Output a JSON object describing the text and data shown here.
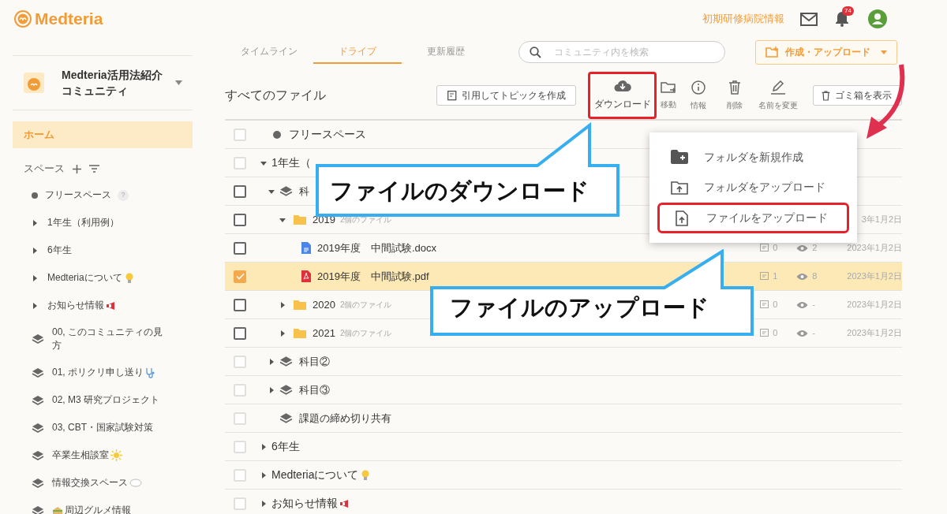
{
  "header": {
    "logo": "Medteria",
    "link": "初期研修病院情報",
    "notification_count": "74"
  },
  "community": {
    "name": "Medteria活用法紹介コミュニティ"
  },
  "sidebar": {
    "home": {
      "label": "ホーム",
      "selected": true
    },
    "spaces_label": "スペース",
    "items": [
      {
        "kind": "dot",
        "label": "フリースペース",
        "help": "?"
      },
      {
        "kind": "group",
        "label": "1年生（利用例）"
      },
      {
        "kind": "group",
        "label": "6年生"
      },
      {
        "kind": "group",
        "label": "Medteriaについて"
      },
      {
        "kind": "group",
        "label": "お知らせ情報"
      },
      {
        "kind": "space",
        "label": "00, このコミュニティの見方"
      },
      {
        "kind": "space",
        "label": "01, ポリクリ申し送り"
      },
      {
        "kind": "space",
        "label": "02, M3 研究プロジェクト"
      },
      {
        "kind": "space",
        "label": "03, CBT・国家試験対策"
      },
      {
        "kind": "space",
        "label": "卒業生相談室"
      },
      {
        "kind": "space",
        "label": "情報交換スペース"
      },
      {
        "kind": "space",
        "label": "周辺グルメ情報"
      }
    ]
  },
  "tabs": [
    {
      "label": "タイムライン",
      "selected": false
    },
    {
      "label": "ドライブ",
      "selected": true
    },
    {
      "label": "更新履歴",
      "selected": false
    }
  ],
  "search": {
    "placeholder": "コミュニティ内を検索"
  },
  "create_button": "作成・アップロード",
  "files": {
    "heading": "すべてのファイル",
    "quote_button": "引用してトピックを作成",
    "actions": [
      {
        "kind": "download",
        "label": "ダウンロード",
        "highlighted": true
      },
      {
        "kind": "move",
        "label": "移動",
        "highlighted": false
      },
      {
        "kind": "info",
        "label": "情報",
        "highlighted": false
      },
      {
        "kind": "delete",
        "label": "削除",
        "highlighted": false
      },
      {
        "kind": "rename",
        "label": "名前を変更",
        "highlighted": false
      }
    ],
    "trash_button": "ゴミ箱を表示",
    "rows": [
      {
        "kind": "dot",
        "name": "フリースペース",
        "checked": false,
        "disabled": true
      },
      {
        "kind": "group",
        "name": "1年生（",
        "checked": false,
        "disabled": true,
        "expanded": true,
        "children": [
          {
            "kind": "space",
            "name": "科",
            "checked": false,
            "disabled": false,
            "expanded": true,
            "children": [
              {
                "kind": "folder",
                "name": "2019",
                "count": "2個のファイル",
                "checked": false,
                "disabled": false,
                "expanded": true,
                "date": "3年1月2日",
                "children": [
                  {
                    "kind": "doc",
                    "name": "2019年度　中間試験.docx",
                    "checked": false,
                    "disabled": false,
                    "comments": "0",
                    "views": "2",
                    "date": "2023年1月2日"
                  },
                  {
                    "kind": "pdf",
                    "name": "2019年度　中間試験.pdf",
                    "checked": true,
                    "disabled": false,
                    "comments": "1",
                    "views": "8",
                    "date": "2023年1月2日"
                  }
                ]
              },
              {
                "kind": "folder",
                "name": "2020",
                "count": "2個のファイル",
                "checked": false,
                "disabled": false,
                "expanded": false,
                "comments": "0",
                "views": "-",
                "date": "2023年1月2日"
              },
              {
                "kind": "folder",
                "name": "2021",
                "count": "2個のファイル",
                "checked": false,
                "disabled": false,
                "expanded": false,
                "comments": "0",
                "views": "-",
                "date": "2023年1月2日"
              }
            ]
          },
          {
            "kind": "space",
            "name": "科目②",
            "checked": false,
            "disabled": true,
            "expanded": false
          },
          {
            "kind": "space",
            "name": "科目③",
            "checked": false,
            "disabled": true,
            "expanded": false
          },
          {
            "kind": "space",
            "name": "課題の締め切り共有",
            "checked": false,
            "disabled": true
          }
        ]
      },
      {
        "kind": "group",
        "name": "6年生",
        "checked": false,
        "disabled": true,
        "expanded": false
      },
      {
        "kind": "group",
        "name": "Medteriaについて",
        "checked": false,
        "disabled": true,
        "expanded": false
      },
      {
        "kind": "group",
        "name": "お知らせ情報",
        "checked": false,
        "disabled": true,
        "expanded": false
      }
    ]
  },
  "menu": {
    "items": [
      {
        "kind": "new_folder",
        "label": "フォルダを新規作成",
        "highlighted": false
      },
      {
        "kind": "upload_folder",
        "label": "フォルダをアップロード",
        "highlighted": false
      },
      {
        "kind": "upload_file",
        "label": "ファイルをアップロード",
        "highlighted": true
      }
    ]
  },
  "callouts": [
    {
      "text": "ファイルのダウンロード"
    },
    {
      "text": "ファイルのアップロード"
    }
  ]
}
